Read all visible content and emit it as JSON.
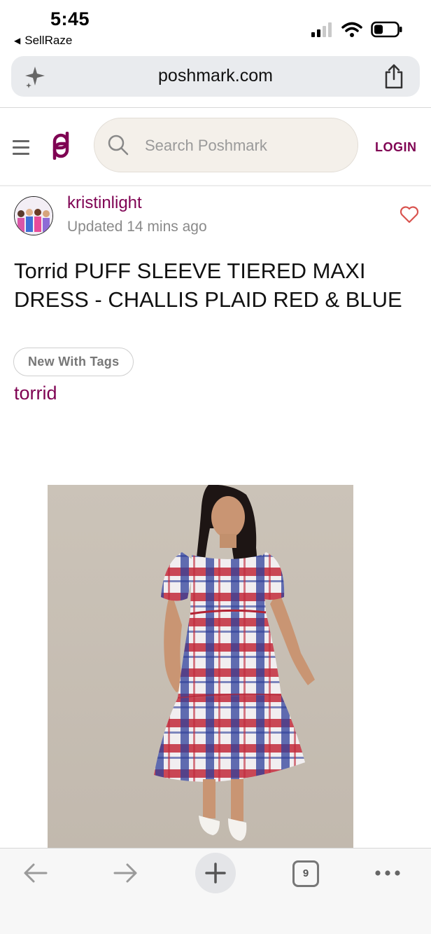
{
  "status_bar": {
    "time": "5:45",
    "back_app": "SellRaze",
    "icons": [
      "signal-icon",
      "wifi-icon",
      "battery-icon"
    ]
  },
  "browser": {
    "url": "poshmark.com",
    "icons": [
      "sparkle-icon",
      "share-icon"
    ]
  },
  "header": {
    "search_placeholder": "Search Poshmark",
    "login_label": "LOGIN",
    "brand_color": "#7f0353"
  },
  "listing": {
    "seller_name": "kristinlight",
    "updated": "Updated 14 mins ago",
    "title": "Torrid PUFF SLEEVE TIERED MAXI DRESS - CHALLIS PLAID RED & BLUE",
    "condition_tag": "New With Tags",
    "brand": "torrid"
  },
  "toolbar": {
    "tab_count": "9",
    "icons": [
      "back-arrow-icon",
      "forward-arrow-icon",
      "new-tab-plus-icon",
      "tabs-icon",
      "more-icon"
    ]
  }
}
